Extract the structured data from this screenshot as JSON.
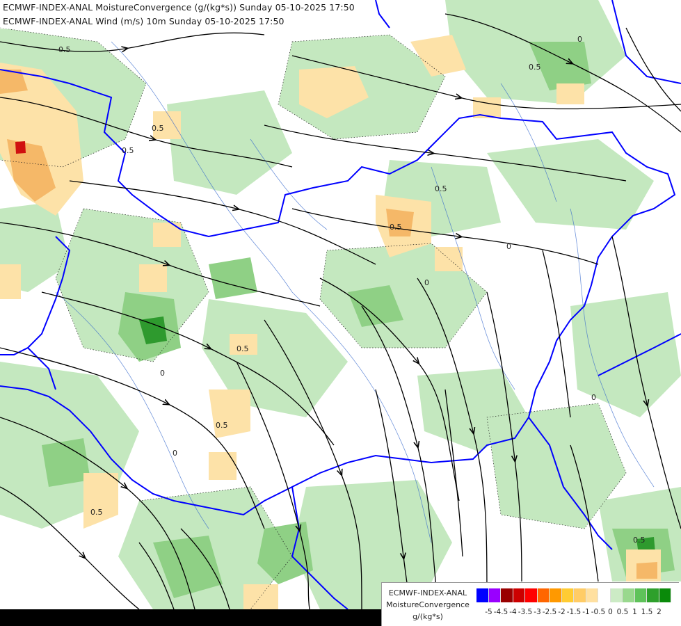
{
  "title": {
    "line1": "ECMWF-INDEX-ANAL MoistureConvergence (g/(kg*s)) Sunday 05-10-2025 17:50",
    "line2": "ECMWF-INDEX-ANAL Wind (m/s) 10m Sunday 05-10-2025 17:50"
  },
  "legend": {
    "line1": "ECMWF-INDEX-ANAL",
    "line2": "MoistureConvergence",
    "line3": "g/(kg*s)",
    "colors": [
      "#0000ff",
      "#9900ff",
      "#990000",
      "#cc0000",
      "#ff0000",
      "#ff6600",
      "#ff9900",
      "#ffcc33",
      "#ffcc66",
      "#ffe0a0",
      "#ffffff",
      "#ccebc5",
      "#99d88e",
      "#5fc25a",
      "#2ea02c",
      "#0a8a0a"
    ],
    "ticks": [
      "-5",
      "-4.5",
      "-4",
      "-3.5",
      "-3",
      "-2.5",
      "-2",
      "-1.5",
      "-1",
      "-0.5",
      "0",
      "0.5",
      "1",
      "1.5",
      "2"
    ]
  },
  "contour_labels": [
    "0.5",
    "0",
    "0",
    "0.5",
    "0.5",
    "0.5",
    "0",
    "0.5",
    "0",
    "0.5",
    "0.5",
    "0",
    "0.5",
    "0",
    "0.5",
    "0.5"
  ],
  "colors": {
    "border": "#0000ff",
    "river": "#3366cc",
    "streamline": "#000000",
    "green_light": "#c4e8bf",
    "green_mid": "#8fd085",
    "green_dark": "#2e9a2e",
    "orange_light": "#fde2a8",
    "orange_mid": "#f5b868",
    "red": "#d01010"
  }
}
